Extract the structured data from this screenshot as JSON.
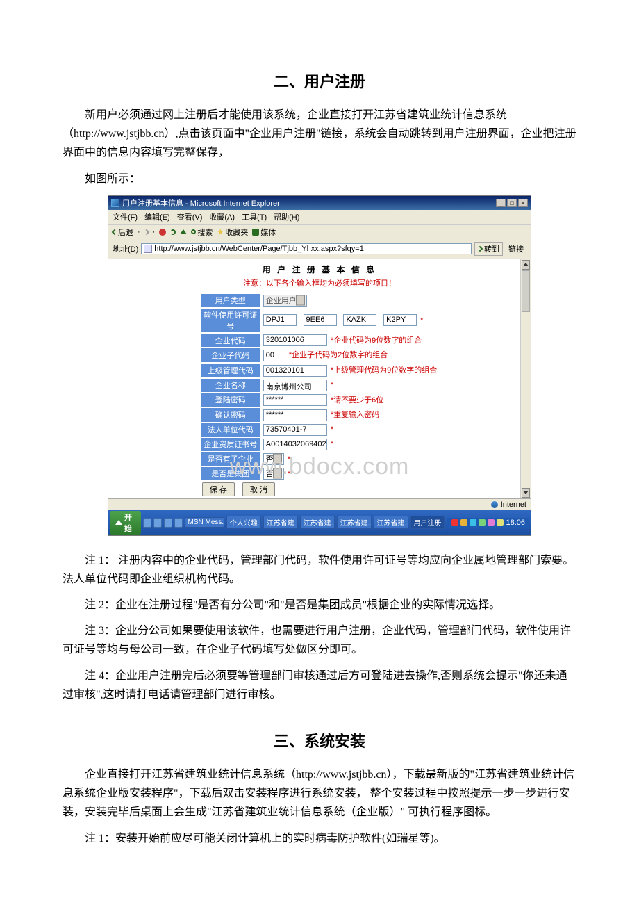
{
  "section1": {
    "title": "二、用户注册",
    "intro": "新用户必须通过网上注册后才能使用该系统，企业直接打开江苏省建筑业统计信息系统（http://www.jstjbb.cn）,点击该页面中\"企业用户注册\"链接，系统会自动跳转到用户注册界面，企业把注册界面中的信息内容填写完整保存，",
    "caption": "如图所示：",
    "notes": {
      "n1": "注 1： 注册内容中的企业代码，管理部门代码，软件使用许可证号等均应向企业属地管理部门索要。法人单位代码即企业组织机构代码。",
      "n2": "注 2：企业在注册过程\"是否有分公司\"和\"是否是集团成员\"根据企业的实际情况选择。",
      "n3": "注 3：企业分公司如果要使用该软件，也需要进行用户注册，企业代码，管理部门代码，软件使用许可证号等均与母公司一致，在企业子代码填写处做区分即可。",
      "n4": "注 4：企业用户注册完后必须要等管理部门审核通过后方可登陆进去操作,否则系统会提示\"你还未通过审核\",这时请打电话请管理部门进行审核。"
    }
  },
  "section2": {
    "title": "三、系统安装",
    "p1": "企业直接打开江苏省建筑业统计信息系统（http://www.jstjbb.cn），下载最新版的\"江苏省建筑业统计信息系统企业版安装程序\"，下载后双击安装程序进行系统安装， 整个安装过程中按照提示一步一步进行安装，安装完毕后桌面上会生成\"江苏省建筑业统计信息系统（企业版）\" 可执行程序图标。",
    "n1": "注 1：安装开始前应尽可能关闭计算机上的实时病毒防护软件(如瑞星等)。"
  },
  "browser": {
    "title": "用户注册基本信息 - Microsoft Internet Explorer",
    "menus": {
      "file": "文件(F)",
      "edit": "编辑(E)",
      "view": "查看(V)",
      "fav": "收藏(A)",
      "tools": "工具(T)",
      "help": "帮助(H)"
    },
    "toolbar": {
      "back": "后退",
      "search": "搜索",
      "fav": "收藏夹",
      "media": "媒体"
    },
    "address_label": "地址(D)",
    "url": "http://www.jstjbb.cn/WebCenter/Page/Tjbb_Yhxx.aspx?sfqy=1",
    "go": "转到",
    "links": "链接",
    "page_title": "用 户 注 册 基 本 信 息",
    "page_notice": "注意：以下各个输入框均为必须填写的项目！",
    "form": {
      "user_type": {
        "label": "用户类型",
        "value": "企业用户"
      },
      "license": {
        "label": "软件使用许可证号",
        "v1": "DPJ1",
        "v2": "9EE6",
        "v3": "KAZK",
        "v4": "K2PY"
      },
      "code": {
        "label": "企业代码",
        "value": "320101006",
        "hint": "*企业代码为9位数字的组合"
      },
      "subcode": {
        "label": "企业子代码",
        "value": "00",
        "hint": "*企业子代码为2位数字的组合"
      },
      "mgmt": {
        "label": "上级管理代码",
        "value": "001320101",
        "hint": "*上级管理代码为9位数字的组合"
      },
      "name": {
        "label": "企业名称",
        "value": "南京博州公司"
      },
      "pwd": {
        "label": "登陆密码",
        "value": "******",
        "hint": "*请不要少于6位"
      },
      "pwd2": {
        "label": "确认密码",
        "value": "******",
        "hint": "*重复输入密码"
      },
      "legal": {
        "label": "法人单位代码",
        "value": "73570401-7"
      },
      "cert": {
        "label": "企业资质证书号",
        "value": "A0014032069402"
      },
      "hassub": {
        "label": "是否有子企业",
        "value": "否"
      },
      "isgroup": {
        "label": "是否是集团",
        "value": "否"
      },
      "save": "保 存",
      "cancel": "取 消"
    },
    "statusbar": {
      "done": "",
      "zone": "Internet"
    },
    "taskbar": {
      "start": "开始",
      "tasks": [
        "MSN Mess...",
        "个人兴趣...",
        "江苏省建...",
        "江苏省建...",
        "江苏省建...",
        "江苏省建...",
        "用户注册..."
      ],
      "time": "18:06"
    }
  },
  "watermark": "www.bdocx.com"
}
